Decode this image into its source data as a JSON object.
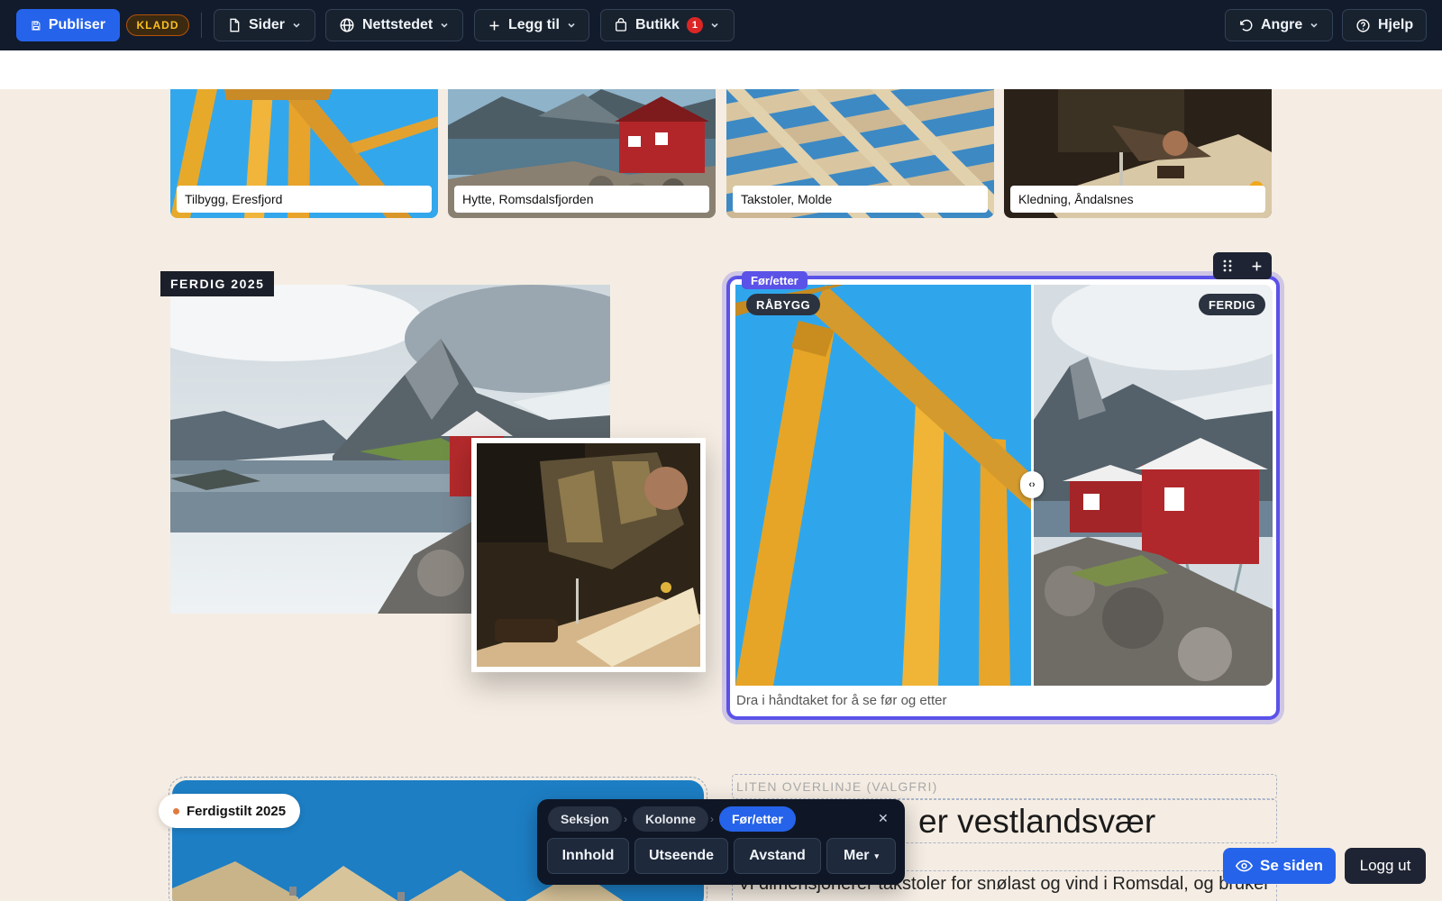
{
  "toolbar": {
    "publish_label": "Publiser",
    "status_badge": "KLADD",
    "pages_label": "Sider",
    "website_label": "Nettstedet",
    "add_label": "Legg til",
    "shop_label": "Butikk",
    "shop_count": "1",
    "undo_label": "Angre",
    "help_label": "Hjelp"
  },
  "gallery": {
    "items": [
      {
        "caption": "Tilbygg, Eresfjord"
      },
      {
        "caption": "Hytte, Romsdalsfjorden"
      },
      {
        "caption": "Takstoler, Molde"
      },
      {
        "caption": "Kledning, Åndalsnes"
      }
    ]
  },
  "collage": {
    "tag": "FERDIG 2025"
  },
  "before_after": {
    "block_label": "Før/etter",
    "before_label": "RÅBYGG",
    "after_label": "FERDIG",
    "handle_glyph": "‹›",
    "caption": "Dra i håndtaket for å se før og etter"
  },
  "bottom": {
    "completed_pill": "Ferdigstilt 2025",
    "overline": "LITEN OVERLINJE (VALGFRI)",
    "headline": "er vestlandsvær",
    "body": "Vi dimensjonerer takstoler for snølast og vind i Romsdal, og bruker"
  },
  "floating_toolbar": {
    "breadcrumbs": [
      "Seksjon",
      "Kolonne",
      "Før/etter"
    ],
    "separator": "›",
    "buttons": [
      "Innhold",
      "Utseende",
      "Avstand",
      "Mer"
    ],
    "more_caret": "▾",
    "close_glyph": "✕"
  },
  "footer": {
    "view_site_label": "Se siden",
    "logout_label": "Logg ut"
  },
  "colors": {
    "accent": "#2563eb",
    "selection": "#5b52e8",
    "topbar": "#121b2b",
    "page_bg": "#f5ede3",
    "draft_badge": "#fbbf24",
    "notification": "#dc2626"
  }
}
